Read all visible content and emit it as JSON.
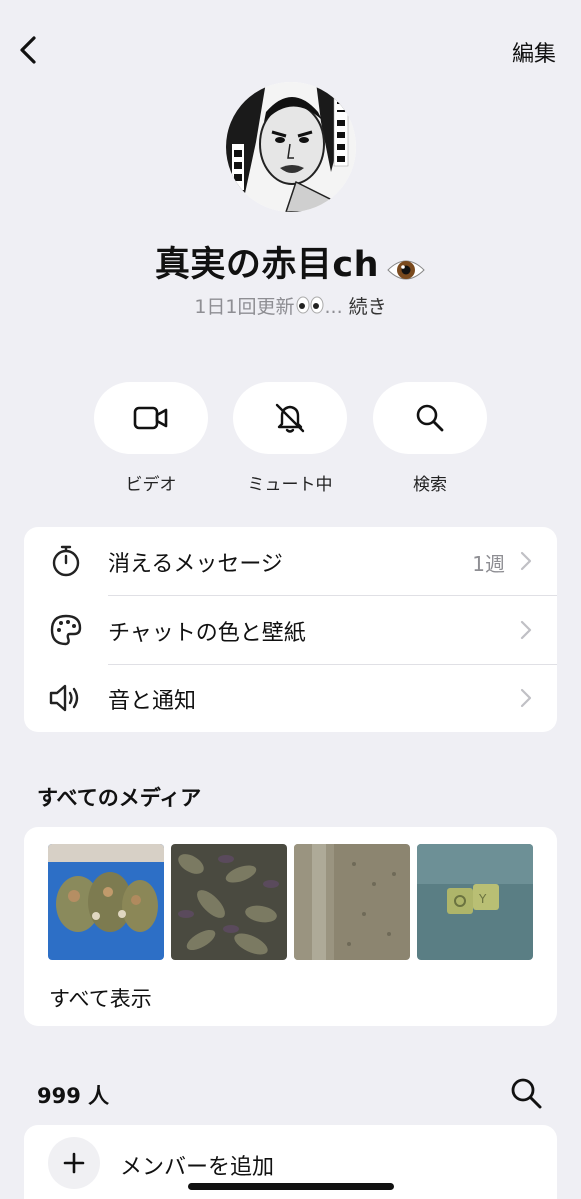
{
  "header": {
    "edit_label": "編集"
  },
  "profile": {
    "name": "真実の赤目ch",
    "description": "1日1回更新",
    "ellipsis": "...",
    "more_label": "続き"
  },
  "actions": [
    {
      "label": "ビデオ",
      "icon": "video-icon"
    },
    {
      "label": "ミュート中",
      "icon": "bell-slash-icon"
    },
    {
      "label": "検索",
      "icon": "search-icon"
    }
  ],
  "settings": [
    {
      "label": "消えるメッセージ",
      "value": "1週",
      "icon": "timer-icon"
    },
    {
      "label": "チャットの色と壁紙",
      "value": "",
      "icon": "palette-icon"
    },
    {
      "label": "音と通知",
      "value": "",
      "icon": "speaker-icon"
    }
  ],
  "media": {
    "title": "すべてのメディア",
    "show_all_label": "すべて表示"
  },
  "members": {
    "count_label": "999 人",
    "add_label": "メンバーを追加"
  },
  "colors": {
    "background": "#efeff4",
    "card": "#ffffff",
    "secondary_text": "#8e8e93"
  }
}
